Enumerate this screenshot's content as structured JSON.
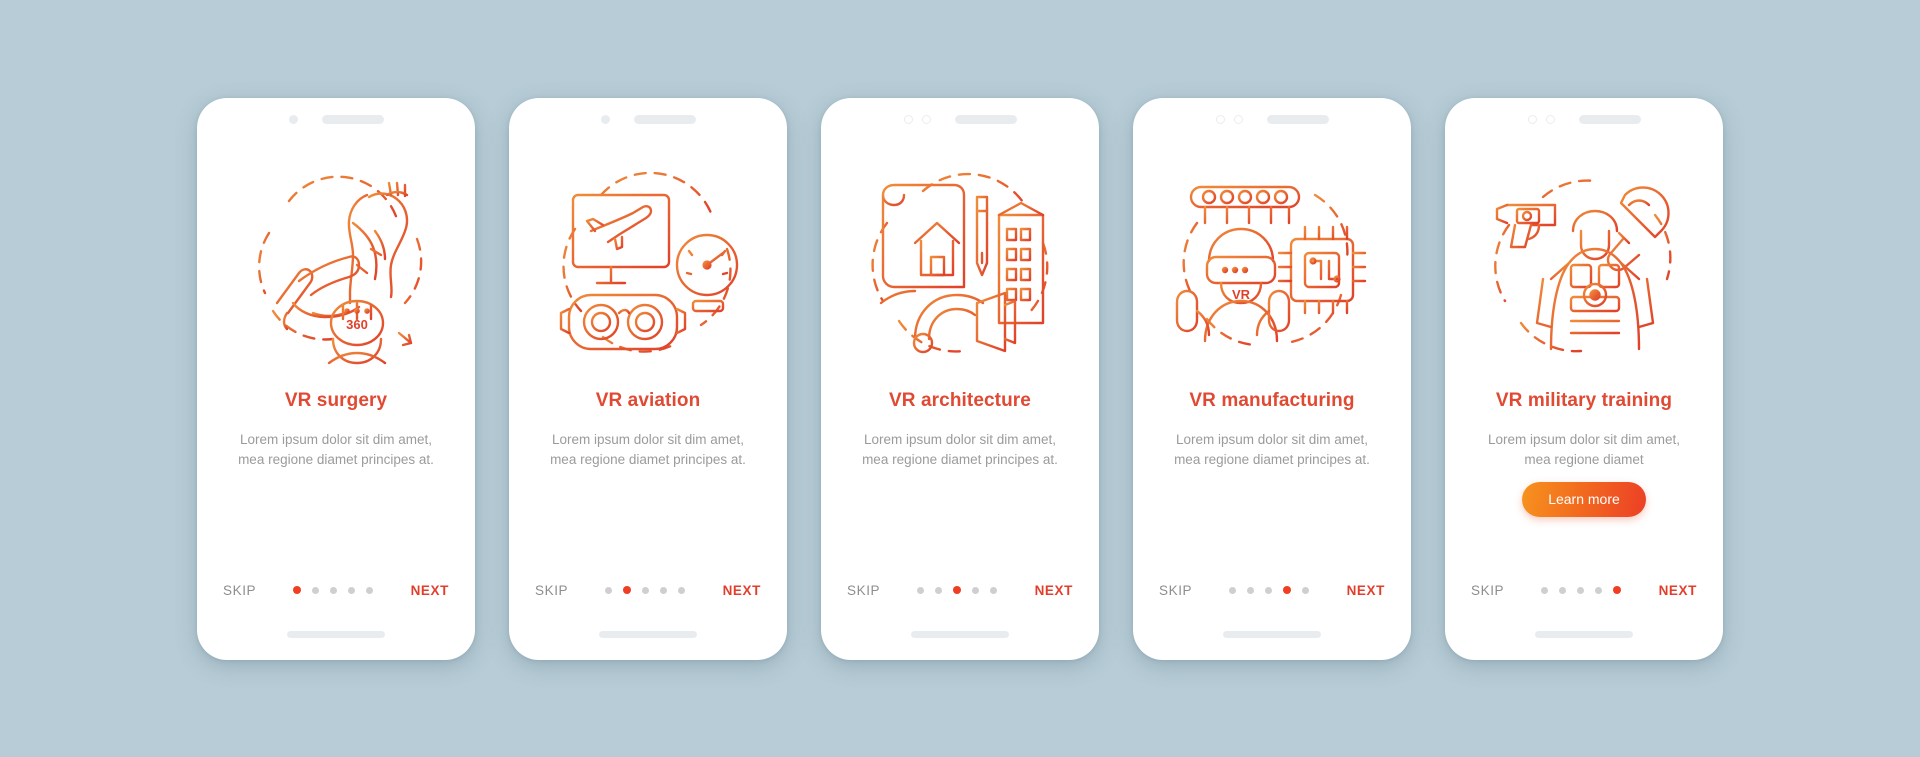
{
  "theme": {
    "background": "#b7ccd6",
    "card_background": "#ffffff",
    "title_color": "#e04a33",
    "body_color": "#9b9b9b",
    "skip_color": "#8e8e8e",
    "next_color": "#e13f2c",
    "dot_active_color": "#ef3e23",
    "dot_inactive_color": "#cfcfcf",
    "button_gradient_from": "#f7931e",
    "button_gradient_to": "#ec3f26",
    "illustration_gradient_from": "#f08c3a",
    "illustration_gradient_to": "#e0412a"
  },
  "total_screens": 5,
  "screens": [
    {
      "index": 1,
      "title": "VR surgery",
      "body": "Lorem ipsum dolor sit dim amet, mea regione diamet principes at.",
      "skip_label": "SKIP",
      "next_label": "NEXT",
      "active_dot": 1,
      "illustration": "vr-surgery-illustration",
      "illustration_label": "360",
      "has_learn_more": false,
      "learn_more_label": ""
    },
    {
      "index": 2,
      "title": "VR aviation",
      "body": "Lorem ipsum dolor sit dim amet, mea regione diamet principes at.",
      "skip_label": "SKIP",
      "next_label": "NEXT",
      "active_dot": 2,
      "illustration": "vr-aviation-illustration",
      "illustration_label": "",
      "has_learn_more": false,
      "learn_more_label": ""
    },
    {
      "index": 3,
      "title": "VR architecture",
      "body": "Lorem ipsum dolor sit dim amet, mea regione diamet principes at.",
      "skip_label": "SKIP",
      "next_label": "NEXT",
      "active_dot": 3,
      "illustration": "vr-architecture-illustration",
      "illustration_label": "",
      "has_learn_more": false,
      "learn_more_label": ""
    },
    {
      "index": 4,
      "title": "VR manufacturing",
      "body": "Lorem ipsum dolor sit dim amet, mea regione diamet principes at.",
      "skip_label": "SKIP",
      "next_label": "NEXT",
      "active_dot": 4,
      "illustration": "vr-manufacturing-illustration",
      "illustration_label": "VR",
      "has_learn_more": false,
      "learn_more_label": ""
    },
    {
      "index": 5,
      "title": "VR military training",
      "body": "Lorem ipsum dolor sit dim amet, mea regione diamet",
      "skip_label": "SKIP",
      "next_label": "NEXT",
      "active_dot": 5,
      "illustration": "vr-military-training-illustration",
      "illustration_label": "",
      "has_learn_more": true,
      "learn_more_label": "Learn more"
    }
  ]
}
